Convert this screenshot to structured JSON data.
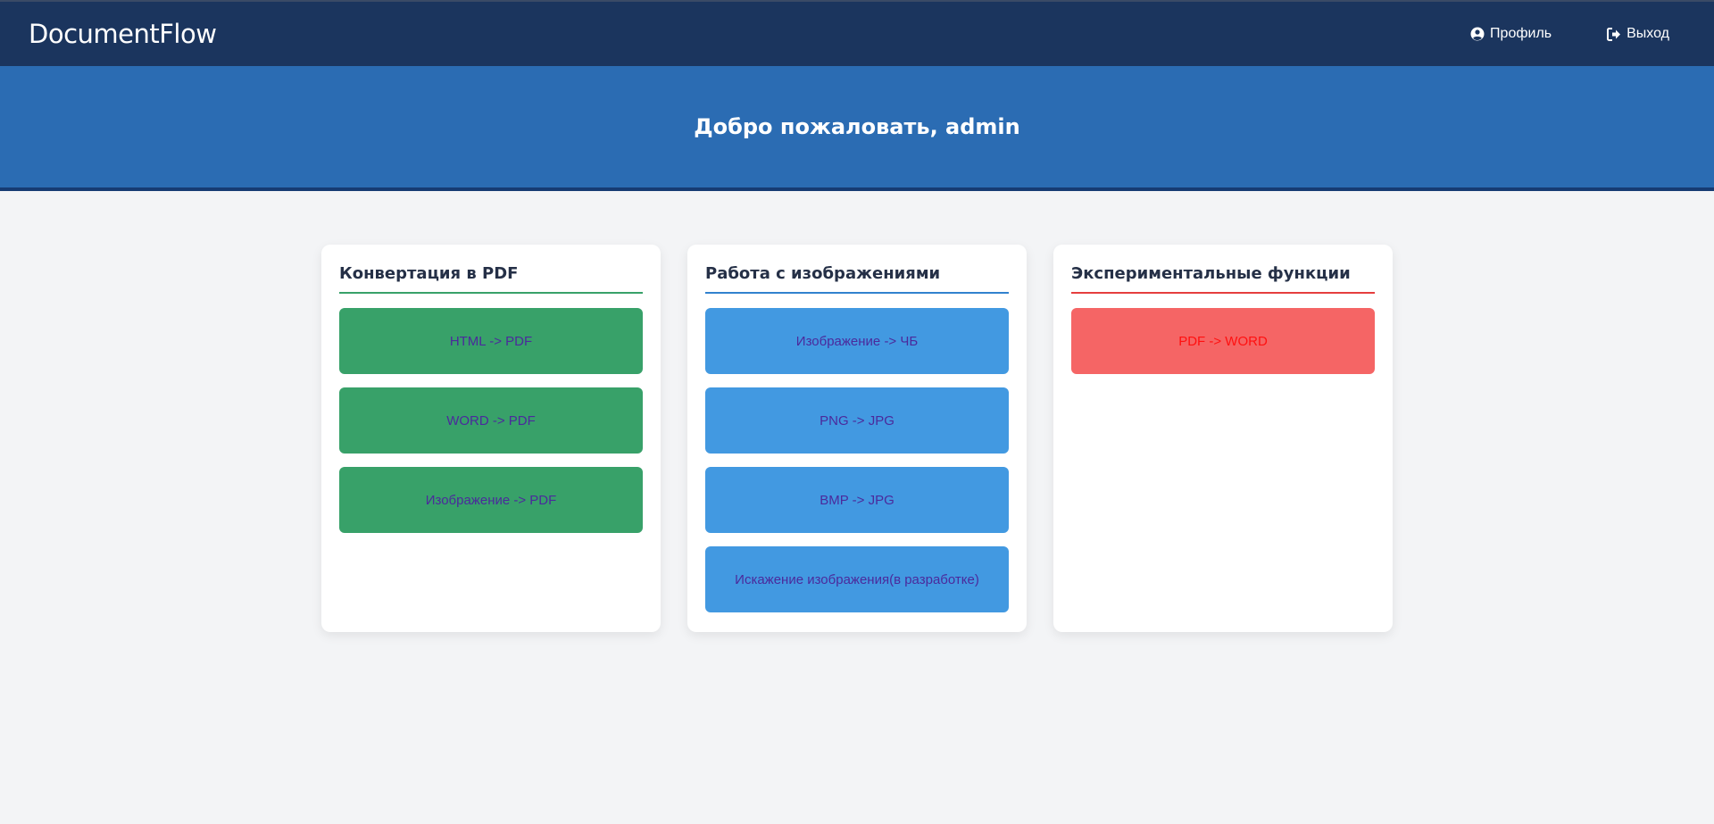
{
  "navbar": {
    "brand": "DocumentFlow",
    "profile_label": "Профиль",
    "profile_icon": "user-circle-icon",
    "logout_label": "Выход",
    "logout_icon": "sign-out-icon"
  },
  "hero": {
    "title": "Добро пожаловать, admin"
  },
  "cards": [
    {
      "title": "Конвертация в PDF",
      "buttons": [
        "HTML -> PDF",
        "WORD -> PDF",
        "Изображение -> PDF"
      ]
    },
    {
      "title": "Работа с изображениями",
      "buttons": [
        "Изображение -> ЧБ",
        "PNG -> JPG",
        "BMP -> JPG",
        "Искажение изображения(в разработке)"
      ]
    },
    {
      "title": "Экспериментальные функции",
      "buttons": [
        "PDF -> WORD"
      ]
    }
  ],
  "colors": {
    "navbar": "#1b355e",
    "hero": "#2b6cb3",
    "green": "#38a169",
    "blue": "#4299e1",
    "red": "#f56565",
    "button_text": "#4b2a9c",
    "red_button_text": "#ff1010"
  }
}
